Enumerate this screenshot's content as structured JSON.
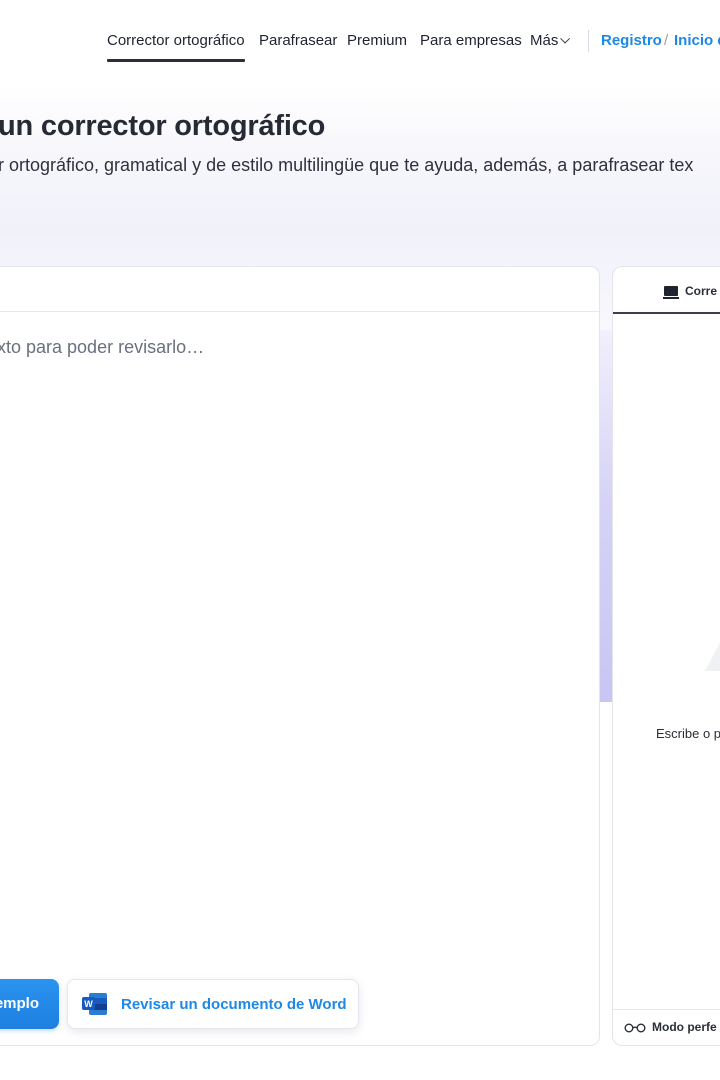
{
  "nav": {
    "items": [
      {
        "label": "Corrector ortográfico",
        "active": true
      },
      {
        "label": "Parafrasear"
      },
      {
        "label": "Premium"
      },
      {
        "label": "Para empresas"
      },
      {
        "label": "Más"
      }
    ],
    "register": "Registro",
    "separator": "/",
    "login": "Inicio d"
  },
  "hero": {
    "title": "un corrector ortográfico",
    "subtitle": "r ortográfico, gramatical y de estilo multilingüe que te ayuda, además, a parafrasear tex"
  },
  "editor": {
    "placeholder": "xto para poder revisarlo…",
    "example_button": "emplo",
    "word_button": "Revisar un documento de Word",
    "word_icon_letter": "W"
  },
  "panel": {
    "tab_label": "Corre",
    "hint": "Escribe o p",
    "footer_label": "Modo perfe"
  },
  "colors": {
    "accent": "#1e88e5",
    "text": "#1f2330",
    "purple_strip": "#c9c5f4",
    "word_blue": "#185abd"
  },
  "icons": [
    "chevron-down-icon",
    "word-icon",
    "monitor-icon",
    "glasses-icon"
  ]
}
